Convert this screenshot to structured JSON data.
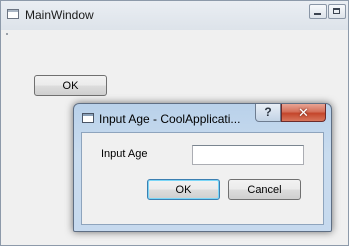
{
  "main_window": {
    "title": "MainWindow",
    "ok_label": "OK"
  },
  "dialog": {
    "title": "Input Age - CoolApplicati...",
    "help_label": "?",
    "close_label": "✕",
    "age_label": "Input Age",
    "age_value": "",
    "ok_label": "OK",
    "cancel_label": "Cancel"
  },
  "icons": [
    "app-icon",
    "minimize-icon",
    "maximize-icon",
    "help-icon",
    "close-icon"
  ]
}
